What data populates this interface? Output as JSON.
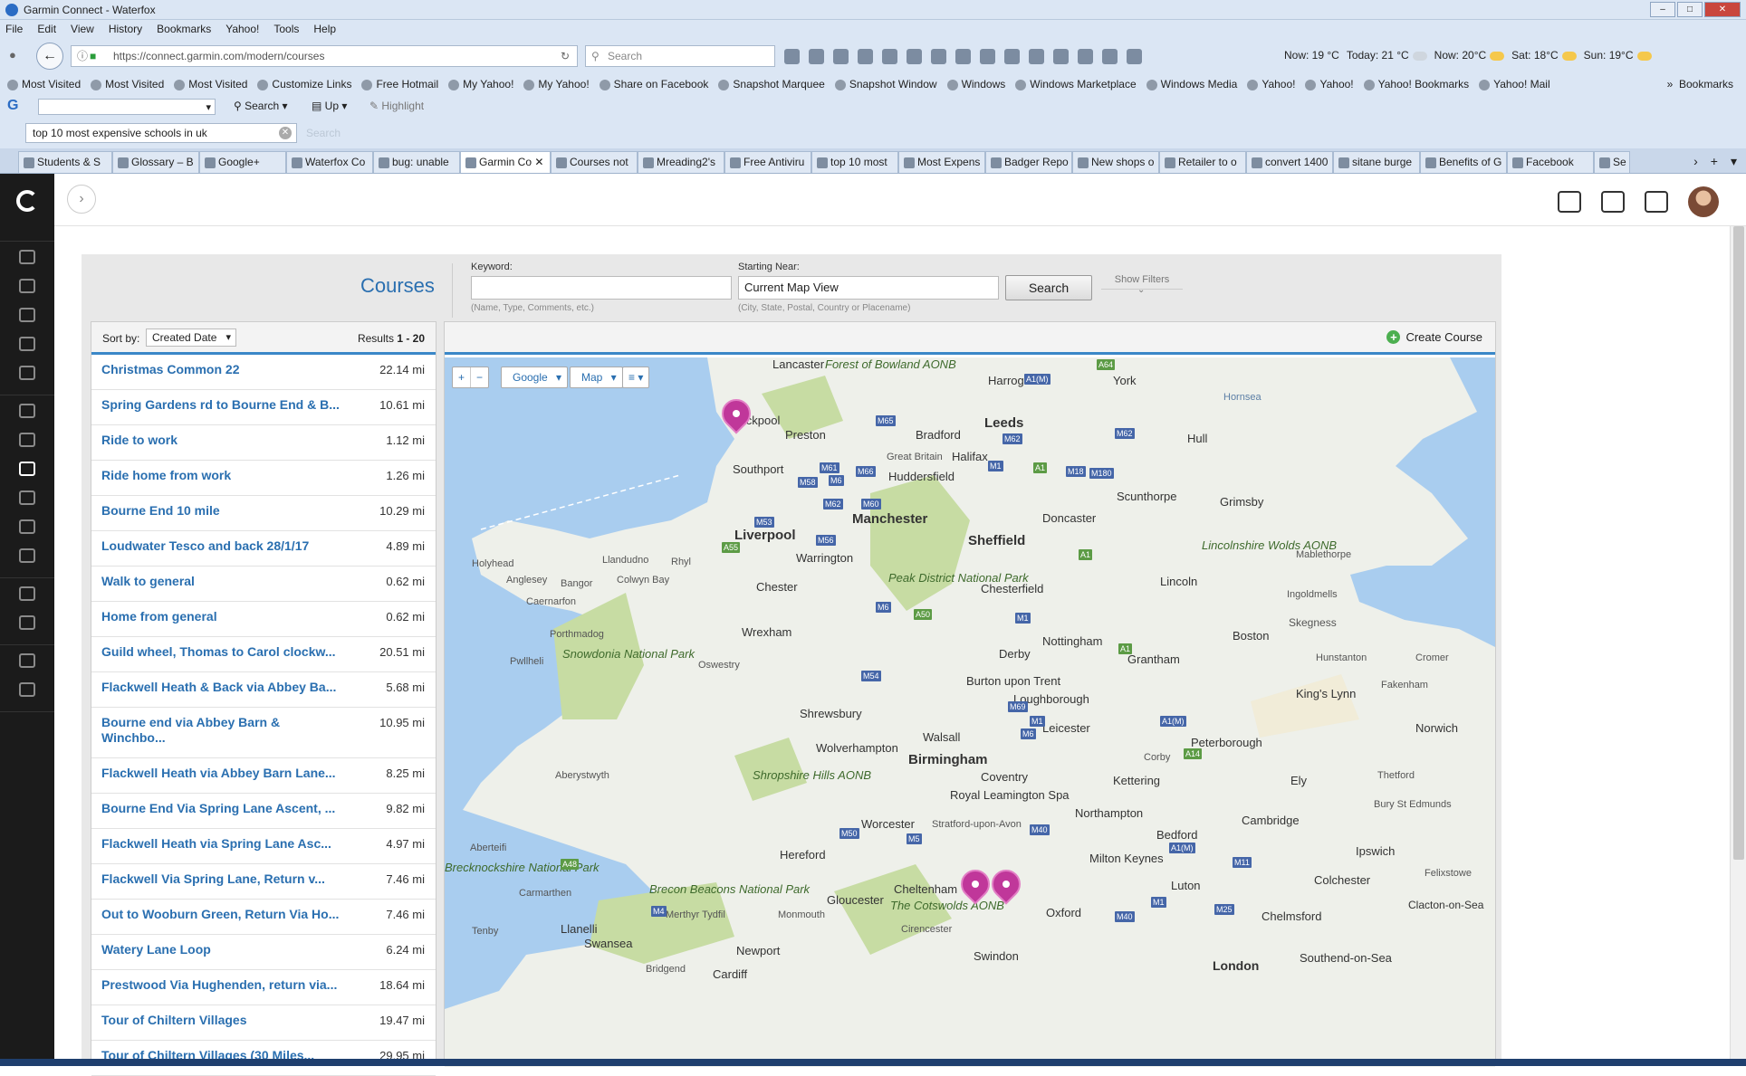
{
  "window": {
    "title": "Garmin Connect - Waterfox"
  },
  "menu": [
    "File",
    "Edit",
    "View",
    "History",
    "Bookmarks",
    "Yahoo!",
    "Tools",
    "Help"
  ],
  "nav": {
    "url": "https://connect.garmin.com/modern/courses",
    "search_placeholder": "Search"
  },
  "weather": [
    {
      "label": "Now: 19 °C"
    },
    {
      "label": "Today: 21 °C"
    },
    {
      "label": "Now: 20°C"
    },
    {
      "label": "Sat: 18°C"
    },
    {
      "label": "Sun: 19°C"
    }
  ],
  "bookmarks": [
    "Most Visited",
    "Most Visited",
    "Most Visited",
    "Customize Links",
    "Free Hotmail",
    "My Yahoo!",
    "My Yahoo!",
    "Share on Facebook",
    "Snapshot Marquee",
    "Snapshot Window",
    "Windows",
    "Windows Marketplace",
    "Windows Media",
    "Yahoo!",
    "Yahoo!",
    "Yahoo! Bookmarks",
    "Yahoo! Mail"
  ],
  "bookmarks_right": "Bookmarks",
  "toolbar2": {
    "g_label": "G",
    "search": "Search",
    "up": "Up",
    "highlight": "Highlight"
  },
  "findbar": {
    "value": "top 10 most expensive schools in uk",
    "search_label": "Search"
  },
  "tabs": [
    {
      "label": "Students & S"
    },
    {
      "label": "Glossary – B"
    },
    {
      "label": "Google+"
    },
    {
      "label": "Waterfox Co"
    },
    {
      "label": "bug: unable"
    },
    {
      "label": "Garmin Co"
    },
    {
      "label": "Courses not"
    },
    {
      "label": "Mreading2's"
    },
    {
      "label": "Free Antiviru"
    },
    {
      "label": "top 10 most"
    },
    {
      "label": "Most Expens"
    },
    {
      "label": "Badger Repo"
    },
    {
      "label": "New shops o"
    },
    {
      "label": "Retailer to o"
    },
    {
      "label": "convert 1400"
    },
    {
      "label": "sitane burge"
    },
    {
      "label": "Benefits of G"
    },
    {
      "label": "Facebook"
    },
    {
      "label": "Se"
    }
  ],
  "courses": {
    "title": "Courses",
    "keyword_label": "Keyword:",
    "keyword_value": "",
    "keyword_hint": "(Name, Type, Comments, etc.)",
    "near_label": "Starting Near:",
    "near_value": "Current Map View",
    "near_hint": "(City, State, Postal, Country or Placename)",
    "search_button": "Search",
    "show_filters": "Show Filters",
    "sort_label": "Sort by:",
    "sort_value": "Created Date",
    "results_prefix": "Results",
    "results_range": "1 - 20",
    "create_button": "Create Course",
    "list": [
      {
        "name": "Christmas Common 22",
        "dist": "22.14 mi"
      },
      {
        "name": "Spring Gardens rd to Bourne End & B...",
        "dist": "10.61 mi"
      },
      {
        "name": "Ride to work",
        "dist": "1.12 mi"
      },
      {
        "name": "Ride home from work",
        "dist": "1.26 mi"
      },
      {
        "name": "Bourne End 10 mile",
        "dist": "10.29 mi"
      },
      {
        "name": "Loudwater Tesco and back 28/1/17",
        "dist": "4.89 mi"
      },
      {
        "name": "Walk to general",
        "dist": "0.62 mi"
      },
      {
        "name": "Home from general",
        "dist": "0.62 mi"
      },
      {
        "name": "Guild wheel, Thomas to Carol clockw...",
        "dist": "20.51 mi"
      },
      {
        "name": "Flackwell Heath & Back via Abbey Ba...",
        "dist": "5.68 mi"
      },
      {
        "name": "Bourne end via Abbey Barn & Winchbo...",
        "dist": "10.95 mi"
      },
      {
        "name": "Flackwell Heath via Abbey Barn Lane...",
        "dist": "8.25 mi"
      },
      {
        "name": "Bourne End Via Spring Lane Ascent, ...",
        "dist": "9.82 mi"
      },
      {
        "name": "Flackwell Heath via Spring Lane Asc...",
        "dist": "4.97 mi"
      },
      {
        "name": "Flackwell Via Spring Lane, Return v...",
        "dist": "7.46 mi"
      },
      {
        "name": "Out to Wooburn Green, Return Via Ho...",
        "dist": "7.46 mi"
      },
      {
        "name": "Watery Lane Loop",
        "dist": "6.24 mi"
      },
      {
        "name": "Prestwood Via Hughenden, return via...",
        "dist": "18.64 mi"
      },
      {
        "name": "Tour of Chiltern Villages",
        "dist": "19.47 mi"
      },
      {
        "name": "Tour of Chiltern Villages (30 Miles...",
        "dist": "29.95 mi"
      }
    ]
  },
  "map": {
    "zoom_in": "+",
    "zoom_out": "−",
    "provider": "Google",
    "type": "Map",
    "places": [
      "Lancaster",
      "Forest of Bowland AONB",
      "Harrogate",
      "York",
      "Hornsea",
      "Blackpool",
      "Preston",
      "Bradford",
      "Leeds",
      "Hull",
      "Southport",
      "Great Britain",
      "Halifax",
      "Huddersfield",
      "Scunthorpe",
      "Grimsby",
      "Manchester",
      "Liverpool",
      "Doncaster",
      "Sheffield",
      "Lincolnshire Wolds AONB",
      "Mablethorpe",
      "Holyhead",
      "Anglesey",
      "Llandudno",
      "Rhyl",
      "Colwyn Bay",
      "Bangor",
      "Warrington",
      "Caernarfon",
      "Chester",
      "Peak District National Park",
      "Chesterfield",
      "Lincoln",
      "Ingoldmells",
      "Skegness",
      "Wrexham",
      "Snowdonia National Park",
      "Porthmadog",
      "Pwllheli",
      "Oswestry",
      "Nottingham",
      "Derby",
      "Boston",
      "Grantham",
      "Hunstanton",
      "Cromer",
      "Burton upon Trent",
      "Loughborough",
      "King's Lynn",
      "Fakenham",
      "Shrewsbury",
      "Leicester",
      "Norwich",
      "Walsall",
      "Wolverhampton",
      "Peterborough",
      "Birmingham",
      "Corby",
      "Aberystwyth",
      "Shropshire Hills AONB",
      "Coventry",
      "Kettering",
      "Ely",
      "Thetford",
      "Royal Leamington Spa",
      "Bury St Edmunds",
      "Northampton",
      "Worcester",
      "Stratford-upon-Avon",
      "Cambridge",
      "Hereford",
      "Bedford",
      "Ipswich",
      "Milton Keynes",
      "Felixstowe",
      "Aberteifi",
      "Brecknockshire National Park",
      "Cheltenham",
      "Luton",
      "Colchester",
      "Carmarthen",
      "Brecon Beacons National Park",
      "Gloucester",
      "The Cotswolds AONB",
      "Oxford",
      "Chelmsford",
      "Clacton-on-Sea",
      "Merthyr Tydfil",
      "Monmouth",
      "Llanelli",
      "Swansea",
      "Cirencester",
      "Tenby",
      "Newport",
      "Swindon",
      "Southend-on-Sea",
      "London",
      "Bridgend",
      "Cardiff"
    ]
  },
  "colors": {
    "accent": "#2a6fb0",
    "pin": "#c0379a",
    "sidebar": "#1b1b1b",
    "sea": "#a9cdef"
  }
}
